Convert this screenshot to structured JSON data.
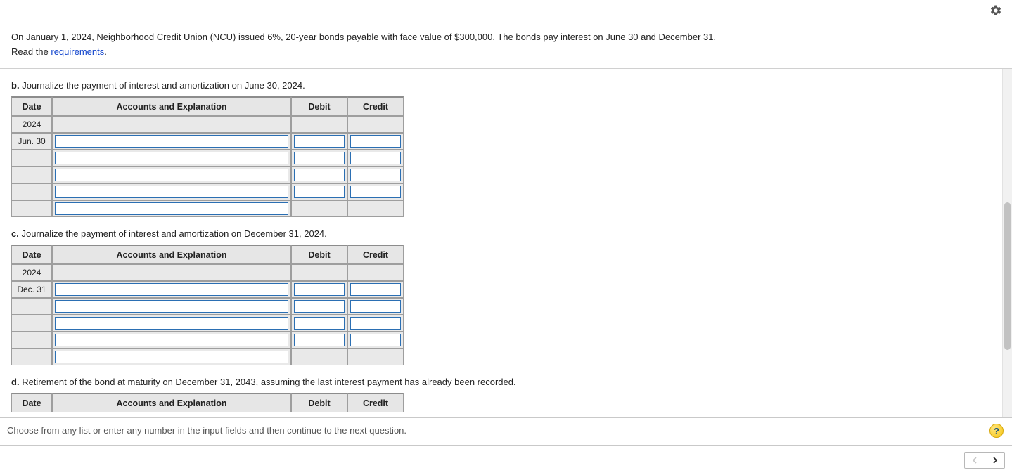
{
  "intro": {
    "problem_text": "On January 1, 2024, Neighborhood Credit Union (NCU) issued 6%, 20-year bonds payable with face value of $300,000. The bonds pay interest on June 30 and December 31.",
    "read_prefix": "Read the ",
    "requirements_link": "requirements",
    "read_suffix": "."
  },
  "columns": {
    "date": "Date",
    "accounts": "Accounts and Explanation",
    "debit": "Debit",
    "credit": "Credit"
  },
  "parts": {
    "b": {
      "label": "b.",
      "prompt": "Journalize the payment of interest and amortization on June 30, 2024.",
      "year": "2024",
      "day": "Jun. 30"
    },
    "c": {
      "label": "c.",
      "prompt": "Journalize the payment of interest and amortization on December 31, 2024.",
      "year": "2024",
      "day": "Dec. 31"
    },
    "d": {
      "label": "d.",
      "prompt": "Retirement of the bond at maturity on December 31, 2043, assuming the last interest payment has already been recorded."
    }
  },
  "footer_hint": "Choose from any list or enter any number in the input fields and then continue to the next question.",
  "help_char": "?"
}
